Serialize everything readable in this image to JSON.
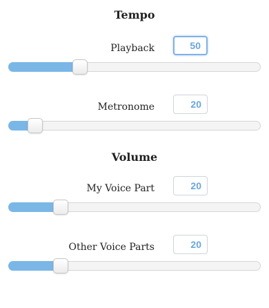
{
  "tempo": {
    "title": "Tempo",
    "controls": [
      {
        "label": "Playback",
        "value": "50",
        "level": 0.27,
        "focused": true
      },
      {
        "label": "Metronome",
        "value": "20",
        "level": 0.08,
        "focused": false
      }
    ]
  },
  "volume": {
    "title": "Volume",
    "controls": [
      {
        "label": "My Voice Part",
        "value": "20",
        "level": 0.19,
        "focused": false
      },
      {
        "label": "Other Voice Parts",
        "value": "20",
        "level": 0.19,
        "focused": false
      }
    ]
  },
  "colors": {
    "accent": "#7ab7e6",
    "value_text": "#6aa5dc",
    "track": "#f4f4f4"
  }
}
